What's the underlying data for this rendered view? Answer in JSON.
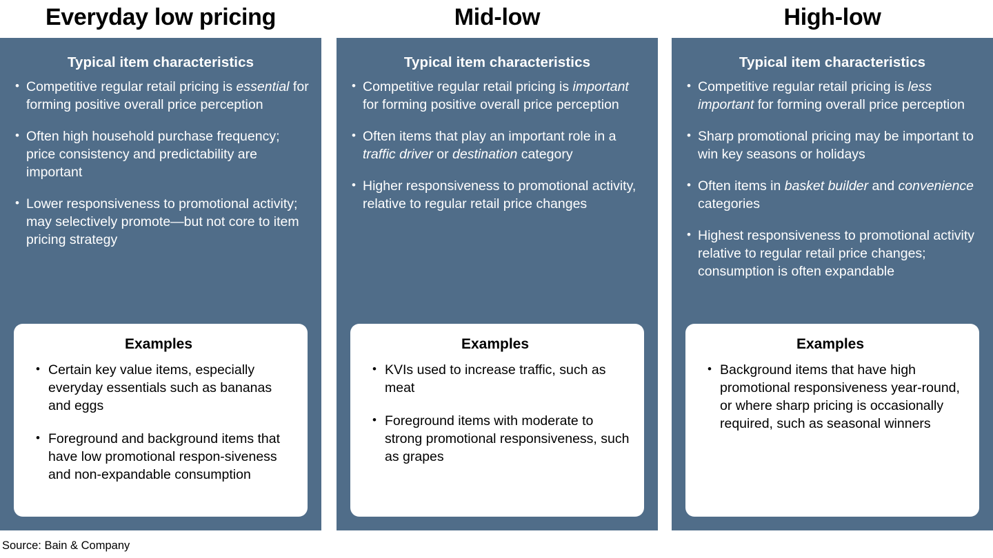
{
  "slide": {
    "source_note": "Source: Bain & Company",
    "accent_color": "#506d89",
    "card_bg": "#ffffff",
    "text_on_accent": "#ffffff"
  },
  "columns": [
    {
      "title": "Everyday low pricing",
      "panel_heading": "Typical item characteristics",
      "characteristics": [
        "Competitive regular retail pricing is <em>essential</em> for forming positive overall price perception",
        "Often high household purchase frequency; price consistency and predictability are important",
        "Lower responsiveness to promotional activity; may selectively promote—but not core to item pricing strategy"
      ],
      "examples_title": "Examples",
      "examples": [
        "Certain key value items, especially everyday essentials such as bananas and eggs",
        "Foreground and background items that have low promotional respon-siveness and non-expandable consumption"
      ]
    },
    {
      "title": "Mid-low",
      "panel_heading": "Typical item characteristics",
      "characteristics": [
        "Competitive regular retail pricing is <em>important</em> for forming positive overall price perception",
        "Often items that play an important role in a <em>traffic driver</em> or <em>destination</em> category",
        "Higher responsiveness to promotional activity, relative to regular retail price changes"
      ],
      "examples_title": "Examples",
      "examples": [
        "KVIs used to increase traffic, such as meat",
        "Foreground items with moderate to strong promotional responsiveness, such as grapes"
      ]
    },
    {
      "title": "High-low",
      "panel_heading": "Typical item characteristics",
      "characteristics": [
        "Competitive regular retail pricing is <em>less important</em> for forming overall price perception",
        "Sharp promotional pricing may be important to win key seasons or holidays",
        "Often items in <em>basket builder</em> and <em>convenience</em> categories",
        "Highest responsiveness to promotional activity relative to regular retail price changes; consumption is often expandable"
      ],
      "examples_title": "Examples",
      "examples": [
        "Background items that have high promotional responsiveness year-round, or where sharp pricing is occasionally required, such as seasonal winners"
      ]
    }
  ]
}
